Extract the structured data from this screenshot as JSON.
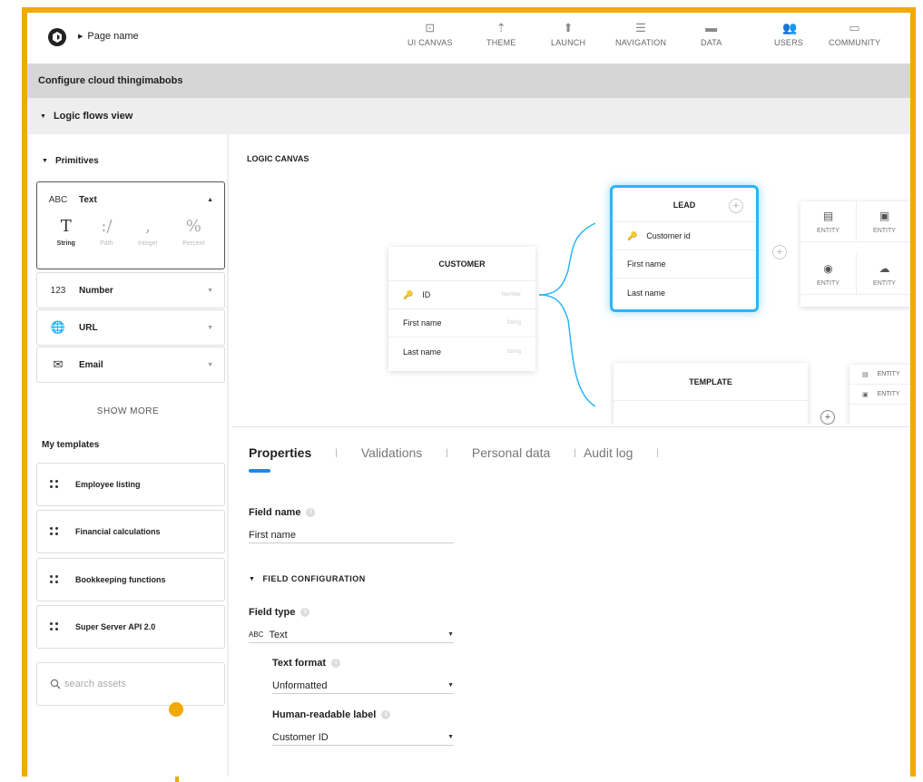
{
  "header": {
    "page_name": "Page name",
    "nav": [
      {
        "label": "UI CANVAS",
        "icon": "canvas-icon"
      },
      {
        "label": "THEME",
        "icon": "brush-icon"
      },
      {
        "label": "LAUNCH",
        "icon": "upload-icon"
      },
      {
        "label": "NAVIGATION",
        "icon": "list-icon"
      },
      {
        "label": "DATA",
        "icon": "folder-icon"
      },
      {
        "label": "USERS",
        "icon": "users-icon"
      },
      {
        "label": "COMMUNITY",
        "icon": "chat-icon"
      }
    ]
  },
  "section_title": "Configure cloud thingimabobs",
  "logic_view_label": "Logic flows view",
  "sidebar": {
    "primitives_label": "Primitives",
    "text": {
      "label": "Text",
      "icon_text": "ABC",
      "subtypes": [
        {
          "glyph": "T",
          "label": "String"
        },
        {
          "glyph": ":/",
          "label": "Path"
        },
        {
          "glyph": "‚",
          "label": "Integer"
        },
        {
          "glyph": "%",
          "label": "Percent"
        }
      ]
    },
    "number": {
      "label": "Number",
      "icon_text": "123"
    },
    "url": {
      "label": "URL"
    },
    "email": {
      "label": "Email"
    },
    "show_more": "SHOW MORE",
    "my_templates_label": "My templates",
    "templates": [
      "Employee listing",
      "Financial calculations",
      "Bookkeeping functions",
      "Super Server API 2.0"
    ],
    "search_placeholder": "search assets"
  },
  "canvas": {
    "title": "LOGIC CANVAS",
    "customer": {
      "title": "CUSTOMER",
      "rows": [
        {
          "name": "ID",
          "type": "Number"
        },
        {
          "name": "First name",
          "type": "String"
        },
        {
          "name": "Last name",
          "type": "String"
        }
      ]
    },
    "lead": {
      "title": "LEAD",
      "rows": [
        "Customer id",
        "First name",
        "Last name"
      ]
    },
    "template": {
      "title": "TEMPLATE"
    },
    "entity_label": "ENTITY",
    "accent_color": "#29b6f6"
  },
  "properties": {
    "tabs": [
      "Properties",
      "Validations",
      "Personal data",
      "Audit log"
    ],
    "field_name_label": "Field name",
    "field_name_value": "First name",
    "field_config_label": "FIELD CONFIGURATION",
    "field_type_label": "Field type",
    "field_type_value": "Text",
    "text_format_label": "Text format",
    "text_format_value": "Unformatted",
    "human_label_label": "Human-readable label",
    "human_label_value": "Customer ID"
  },
  "colors": {
    "frame": "#f2a900",
    "tab_underline": "#1e88e5"
  }
}
